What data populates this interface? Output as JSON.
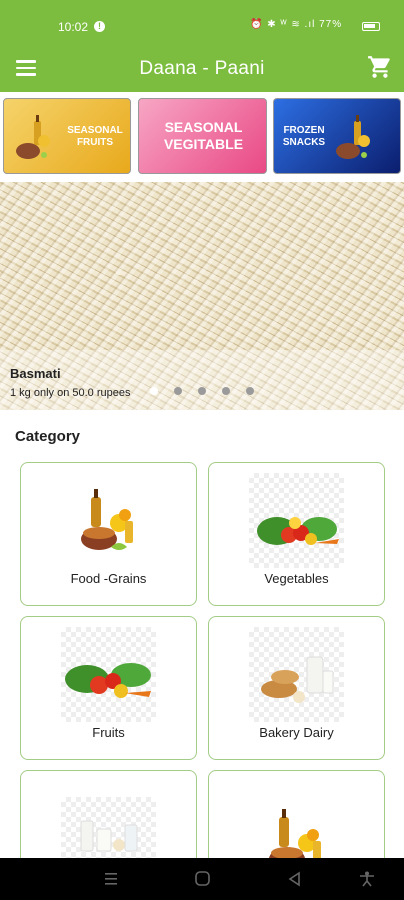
{
  "status_bar": {
    "time": "10:02",
    "notification_badge": "!",
    "system_icons": "⏰ ✱ ᵂ ≋ .ıl 77%",
    "battery_icon": "battery-icon"
  },
  "app_bar": {
    "title": "Daana - Paani",
    "menu_icon": "menu-icon",
    "cart_icon": "cart-icon"
  },
  "banners": [
    {
      "label": "SEASONAL FRUITS"
    },
    {
      "label": "SEASONAL VEGITABLE"
    },
    {
      "label": "FROZEN SNACKS"
    }
  ],
  "hero": {
    "title": "Basmati",
    "subtitle": "1 kg only on 50.0 rupees",
    "slides": 5,
    "active_slide": 1
  },
  "category": {
    "heading": "Category",
    "items": [
      {
        "label": "Food -Grains"
      },
      {
        "label": "Vegetables"
      },
      {
        "label": "Fruits"
      },
      {
        "label": "Bakery Dairy"
      },
      {
        "label": ""
      },
      {
        "label": ""
      }
    ]
  },
  "nav_bar": {
    "icons": [
      "recents-icon",
      "home-icon",
      "back-icon",
      "accessibility-icon"
    ]
  },
  "colors": {
    "primary": "#7cbd3f",
    "card_border": "#a3cc86"
  }
}
